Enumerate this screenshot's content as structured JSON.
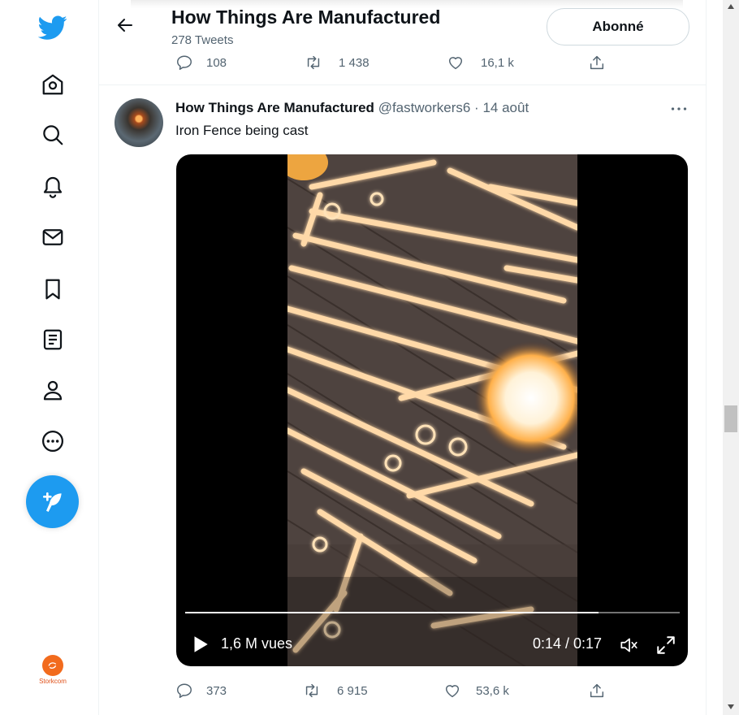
{
  "header": {
    "name": "How Things Are Manufactured",
    "tweet_count": "278 Tweets",
    "follow_label": "Abonné"
  },
  "prev_tweet": {
    "replies": "108",
    "retweets": "1 438",
    "likes": "16,1 k"
  },
  "tweet": {
    "author_name": "How Things Are Manufactured",
    "author_handle": "@fastworkers6",
    "date": "14 août",
    "separator": "·",
    "text": "Iron Fence being cast",
    "video": {
      "views": "1,6 M vues",
      "time": "0:14 / 0:17",
      "progress": 0.836
    },
    "replies": "373",
    "retweets": "6 915",
    "likes": "53,6 k"
  },
  "sidebar": {
    "items": [
      "twitter-logo",
      "home",
      "explore",
      "notifications",
      "messages",
      "bookmarks",
      "lists",
      "profile",
      "more"
    ],
    "account_label": "Storkcom"
  },
  "colors": {
    "brand": "#1d9bf0",
    "text": "#0f1419",
    "secondary": "#536471"
  }
}
